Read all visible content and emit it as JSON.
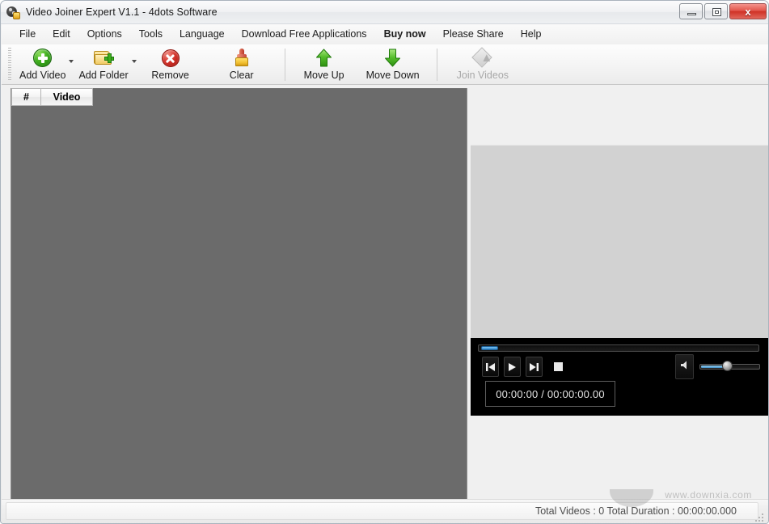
{
  "window": {
    "title": "Video Joiner Expert V1.1 - 4dots Software",
    "icon": "film-reel-icon",
    "minimize_label": "–",
    "maximize_label": "□",
    "close_label": "x"
  },
  "menubar": {
    "items": [
      {
        "label": "File",
        "bold": false
      },
      {
        "label": "Edit",
        "bold": false
      },
      {
        "label": "Options",
        "bold": false
      },
      {
        "label": "Tools",
        "bold": false
      },
      {
        "label": "Language",
        "bold": false
      },
      {
        "label": "Download Free Applications",
        "bold": false
      },
      {
        "label": "Buy now",
        "bold": true
      },
      {
        "label": "Please Share",
        "bold": false
      },
      {
        "label": "Help",
        "bold": false
      }
    ]
  },
  "toolbar": {
    "add_video": {
      "label": "Add Video",
      "icon": "green-plus-circle-icon",
      "has_dropdown": true,
      "enabled": true
    },
    "add_folder": {
      "label": "Add Folder",
      "icon": "folder-plus-icon",
      "has_dropdown": true,
      "enabled": true
    },
    "remove": {
      "label": "Remove",
      "icon": "red-x-circle-icon",
      "enabled": true
    },
    "clear": {
      "label": "Clear",
      "icon": "brush-icon",
      "enabled": true
    },
    "move_up": {
      "label": "Move Up",
      "icon": "green-arrow-up-icon",
      "enabled": true
    },
    "move_down": {
      "label": "Move Down",
      "icon": "green-arrow-down-icon",
      "enabled": true
    },
    "join_videos": {
      "label": "Join Videos",
      "icon": "join-diamond-icon",
      "enabled": false
    }
  },
  "video_list": {
    "columns": [
      {
        "key": "index",
        "label": "#"
      },
      {
        "key": "video",
        "label": "Video"
      }
    ],
    "rows": []
  },
  "preview": {
    "surface_color": "#d2d2d2",
    "player": {
      "seek_position_percent": 1,
      "time_display": "00:00:00 / 00:00:00.00",
      "buttons": {
        "previous": {
          "label": "Previous",
          "icon": "skip-previous-icon"
        },
        "play": {
          "label": "Play",
          "icon": "play-icon"
        },
        "next": {
          "label": "Next",
          "icon": "skip-next-icon"
        },
        "stop": {
          "label": "Stop",
          "icon": "stop-icon"
        }
      },
      "volume": {
        "icon": "speaker-icon",
        "level_percent": 45
      }
    }
  },
  "statusbar": {
    "text": "Total Videos : 0  Total Duration : 00:00:00.000",
    "total_videos": 0,
    "total_duration": "00:00:00.000",
    "resize_grip": "resize-grip-icon"
  },
  "watermark": {
    "text": "www.downxia.com"
  },
  "colors": {
    "accent_green": "#3fae1e",
    "accent_red": "#d2322a",
    "accent_blue": "#2b84cb",
    "list_background": "#6b6b6b",
    "player_background": "#000000"
  }
}
